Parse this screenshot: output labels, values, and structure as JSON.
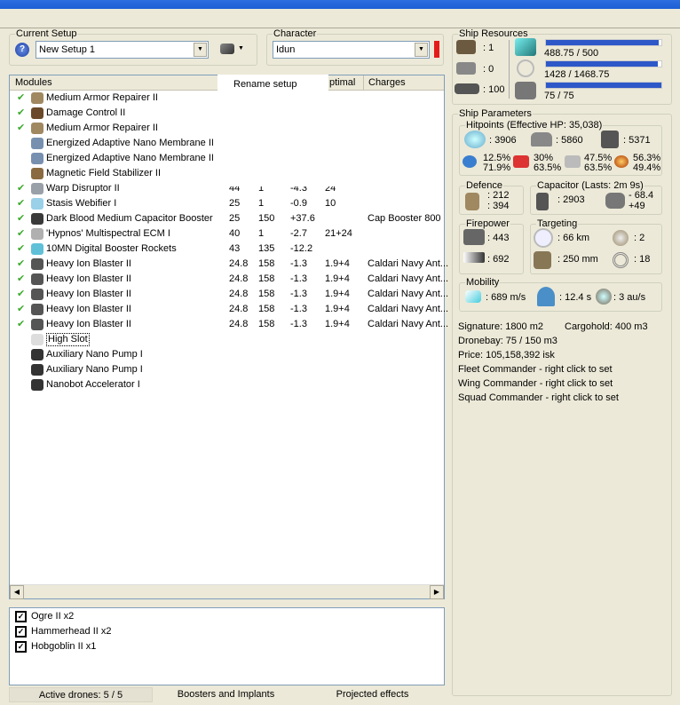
{
  "setup": {
    "label": "Current Setup",
    "value": "New Setup 1"
  },
  "character": {
    "label": "Character",
    "value": "Idun",
    "status_color": "#e41b1b"
  },
  "popup": {
    "item": "Rename setup"
  },
  "modules": {
    "headers": {
      "name": "Modules",
      "optimal": "ptimal",
      "charges": "Charges"
    },
    "rows": [
      {
        "name": "Medium Armor Repairer II",
        "active": true,
        "c1": "",
        "c2": "",
        "c3": "",
        "opt": "",
        "charge": "",
        "color": "#a08860"
      },
      {
        "name": "Damage Control II",
        "active": true,
        "c1": "",
        "c2": "",
        "c3": "",
        "opt": "",
        "charge": "",
        "color": "#6a4a2a"
      },
      {
        "name": "Medium Armor Repairer II",
        "active": true,
        "c1": "",
        "c2": "",
        "c3": "",
        "opt": "",
        "charge": "",
        "color": "#a08860"
      },
      {
        "name": "Energized Adaptive Nano Membrane II",
        "active": false,
        "c1": "",
        "c2": "",
        "c3": "",
        "opt": "",
        "charge": "",
        "color": "#7890b0"
      },
      {
        "name": "Energized Adaptive Nano Membrane II",
        "active": false,
        "c1": "",
        "c2": "",
        "c3": "",
        "opt": "",
        "charge": "",
        "color": "#7890b0"
      },
      {
        "name": "Magnetic Field Stabilizer II",
        "active": false,
        "c1": "",
        "c2": "",
        "c3": "",
        "opt": "",
        "charge": "",
        "color": "#8a6a40"
      },
      {
        "name": "Warp Disruptor II",
        "active": true,
        "c1": "44",
        "c2": "1",
        "c3": "-4.3",
        "opt": "24",
        "charge": "",
        "color": "#9aa0a8"
      },
      {
        "name": "Stasis Webifier I",
        "active": true,
        "c1": "25",
        "c2": "1",
        "c3": "-0.9",
        "opt": "10",
        "charge": "",
        "color": "#9ad0e8"
      },
      {
        "name": "Dark Blood Medium Capacitor Booster",
        "active": true,
        "c1": "25",
        "c2": "150",
        "c3": "+37.6",
        "opt": "",
        "charge": "Cap Booster 800",
        "color": "#3a3a3a"
      },
      {
        "name": "'Hypnos' Multispectral ECM I",
        "active": true,
        "c1": "40",
        "c2": "1",
        "c3": "-2.7",
        "opt": "21+24",
        "charge": "",
        "color": "#b0b0b0"
      },
      {
        "name": "10MN Digital Booster Rockets",
        "active": true,
        "c1": "43",
        "c2": "135",
        "c3": "-12.2",
        "opt": "",
        "charge": "",
        "color": "#60c0d8"
      },
      {
        "name": "Heavy Ion Blaster II",
        "active": true,
        "c1": "24.8",
        "c2": "158",
        "c3": "-1.3",
        "opt": "1.9+4",
        "charge": "Caldari Navy Ant...",
        "color": "#555"
      },
      {
        "name": "Heavy Ion Blaster II",
        "active": true,
        "c1": "24.8",
        "c2": "158",
        "c3": "-1.3",
        "opt": "1.9+4",
        "charge": "Caldari Navy Ant...",
        "color": "#555"
      },
      {
        "name": "Heavy Ion Blaster II",
        "active": true,
        "c1": "24.8",
        "c2": "158",
        "c3": "-1.3",
        "opt": "1.9+4",
        "charge": "Caldari Navy Ant...",
        "color": "#555"
      },
      {
        "name": "Heavy Ion Blaster II",
        "active": true,
        "c1": "24.8",
        "c2": "158",
        "c3": "-1.3",
        "opt": "1.9+4",
        "charge": "Caldari Navy Ant...",
        "color": "#555"
      },
      {
        "name": "Heavy Ion Blaster II",
        "active": true,
        "c1": "24.8",
        "c2": "158",
        "c3": "-1.3",
        "opt": "1.9+4",
        "charge": "Caldari Navy Ant...",
        "color": "#555"
      },
      {
        "name": "High Slot",
        "active": false,
        "c1": "",
        "c2": "",
        "c3": "",
        "opt": "",
        "charge": "",
        "color": "#ddd",
        "empty": true
      },
      {
        "name": "Auxiliary Nano Pump I",
        "active": false,
        "c1": "",
        "c2": "",
        "c3": "",
        "opt": "",
        "charge": "",
        "color": "#333"
      },
      {
        "name": "Auxiliary Nano Pump I",
        "active": false,
        "c1": "",
        "c2": "",
        "c3": "",
        "opt": "",
        "charge": "",
        "color": "#333"
      },
      {
        "name": "Nanobot Accelerator I",
        "active": false,
        "c1": "",
        "c2": "",
        "c3": "",
        "opt": "",
        "charge": "",
        "color": "#333"
      }
    ]
  },
  "drones": [
    {
      "name": "Ogre II x2"
    },
    {
      "name": "Hammerhead II x2"
    },
    {
      "name": "Hobgoblin II x1"
    }
  ],
  "tabs": {
    "drones": "Active drones: 5 / 5",
    "boosters": "Boosters and Implants",
    "projected": "Projected effects"
  },
  "resources": {
    "label": "Ship Resources",
    "turrets": ": 1",
    "launchers": ": 0",
    "calibration": ": 100",
    "cpu": {
      "text": "488.75 / 500",
      "fraction": 0.9775
    },
    "powergrid": {
      "text": "1428 / 1468.75",
      "fraction": 0.9723
    },
    "drone_bw": {
      "text": "75 / 75",
      "fraction": 1.0
    }
  },
  "params": {
    "label": "Ship Parameters",
    "hp": {
      "label": "Hitpoints (Effective HP: 35,038)",
      "shield": ": 3906",
      "armor": ": 5860",
      "structure": ": 5371",
      "em": [
        "12.5%",
        "71.9%"
      ],
      "thermal": [
        "30%",
        "63.5%"
      ],
      "kinetic": [
        "47.5%",
        "63.5%"
      ],
      "explosive": [
        "56.3%",
        "49.4%"
      ]
    },
    "defence": {
      "label": "Defence",
      "v1": ": 212",
      "v2": ": 394"
    },
    "capacitor": {
      "label": "Capacitor (Lasts: 2m 9s)",
      "cap": ": 2903",
      "use": "- 68.4",
      "recharge": "+49"
    },
    "firepower": {
      "label": "Firepower",
      "turret": ": 443",
      "drone": ": 692"
    },
    "targeting": {
      "label": "Targeting",
      "range": ": 66 km",
      "targets": ": 2",
      "scan": ": 250 mm",
      "sensor": ": 18"
    },
    "mobility": {
      "label": "Mobility",
      "speed": ": 689 m/s",
      "align": ": 12.4 s",
      "warp": ": 3 au/s"
    },
    "signature": "Signature: 1800 m2",
    "cargo": "Cargohold: 400 m3",
    "dronebay": "Dronebay: 75 / 150 m3",
    "price": "Price: 105,158,392 isk",
    "fleet": "Fleet Commander - right click to set",
    "wing": "Wing Commander - right click to set",
    "squad": "Squad Commander - right click to set"
  }
}
